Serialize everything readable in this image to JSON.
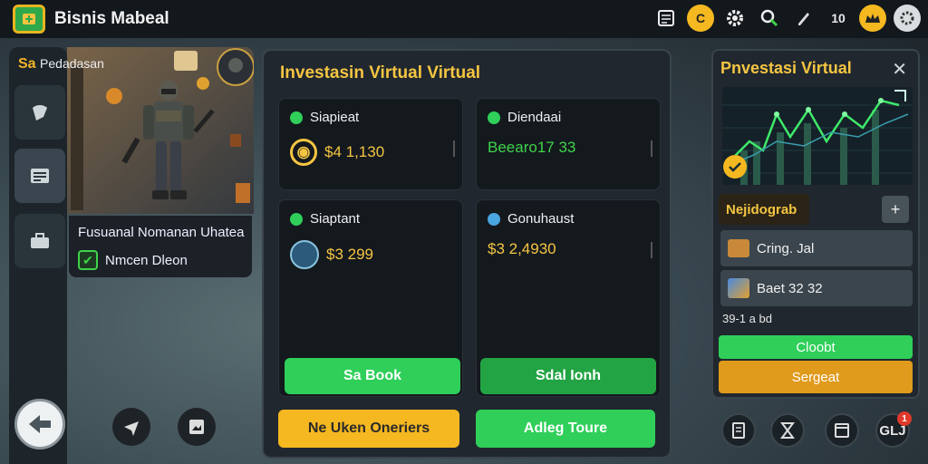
{
  "app": {
    "title": "Bisnis Mabeal"
  },
  "topbar": {
    "icons": [
      "calendar-icon",
      "coin-icon",
      "gear-icon",
      "search-user-icon",
      "pen-icon",
      "level-icon",
      "crown-icon",
      "settings-icon"
    ],
    "level_text": "10"
  },
  "left": {
    "label_prefix": "Sa",
    "label_text": "Pedadasan",
    "character_name": "Fusuanal Nomanan Uhatea",
    "character_sub": "Nmcen Dleon"
  },
  "main": {
    "title": "Investasin Virtual Virtual",
    "cards": [
      {
        "label": "Siapieat",
        "value": "$4 1,130",
        "value_color": "#f5c542"
      },
      {
        "label": "Diendaai",
        "value": "Beearo17 33",
        "value_color": "#3fd34a"
      },
      {
        "label": "Siaptant",
        "value": "$3 299",
        "value_color": "#f5c542"
      },
      {
        "label": "Gonuhaust",
        "value": "$3 2,4930",
        "value_color": "#f5c542"
      }
    ],
    "card_buttons": [
      "Sa Book",
      "Sdal Ionh"
    ],
    "bottom_buttons": [
      "Ne Uken Oneriers",
      "Adleg Toure"
    ]
  },
  "right": {
    "title": "Pnvestasi Virtual",
    "subtitle": "Nejidograb",
    "rows": [
      {
        "icon": "chest-icon",
        "text": "Cring. Jal"
      },
      {
        "icon": "tools-icon",
        "text": "Baet 32 32"
      }
    ],
    "small_text": "39-1 a bd",
    "buttons": [
      "Cloobt",
      "Sergeat"
    ]
  },
  "bottom_right": {
    "last_label": "GLJ",
    "badge": "1"
  },
  "colors": {
    "accent_yellow": "#f5c542",
    "green": "#2fcf5a",
    "orange": "#e09a1c"
  }
}
